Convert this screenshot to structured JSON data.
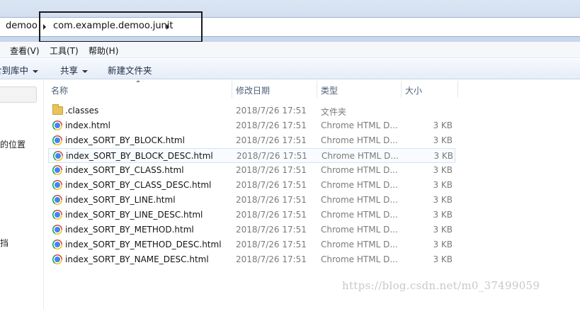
{
  "address_bar": {
    "crumbs": [
      "demoo",
      "com.example.demoo.junit"
    ]
  },
  "menu": {
    "items": [
      "查看(V)",
      "工具(T)",
      "帮助(H)"
    ]
  },
  "toolbar": {
    "include_library": "含到库中",
    "share": "共享",
    "new_folder": "新建文件夹"
  },
  "nav": {
    "item_recent_places": "的位置",
    "item_docs": "挡"
  },
  "columns": {
    "name": "名称",
    "date": "修改日期",
    "type": "类型",
    "size": "大小"
  },
  "files": [
    {
      "name": ".classes",
      "date": "2018/7/26 17:51",
      "type": "文件夹",
      "size": "",
      "icon": "folder-icon"
    },
    {
      "name": "index.html",
      "date": "2018/7/26 17:51",
      "type": "Chrome HTML D...",
      "size": "3 KB",
      "icon": "chrome-icon"
    },
    {
      "name": "index_SORT_BY_BLOCK.html",
      "date": "2018/7/26 17:51",
      "type": "Chrome HTML D...",
      "size": "3 KB",
      "icon": "chrome-icon"
    },
    {
      "name": "index_SORT_BY_BLOCK_DESC.html",
      "date": "2018/7/26 17:51",
      "type": "Chrome HTML D...",
      "size": "3 KB",
      "icon": "chrome-icon",
      "selected": true
    },
    {
      "name": "index_SORT_BY_CLASS.html",
      "date": "2018/7/26 17:51",
      "type": "Chrome HTML D...",
      "size": "3 KB",
      "icon": "chrome-icon"
    },
    {
      "name": "index_SORT_BY_CLASS_DESC.html",
      "date": "2018/7/26 17:51",
      "type": "Chrome HTML D...",
      "size": "3 KB",
      "icon": "chrome-icon"
    },
    {
      "name": "index_SORT_BY_LINE.html",
      "date": "2018/7/26 17:51",
      "type": "Chrome HTML D...",
      "size": "3 KB",
      "icon": "chrome-icon"
    },
    {
      "name": "index_SORT_BY_LINE_DESC.html",
      "date": "2018/7/26 17:51",
      "type": "Chrome HTML D...",
      "size": "3 KB",
      "icon": "chrome-icon"
    },
    {
      "name": "index_SORT_BY_METHOD.html",
      "date": "2018/7/26 17:51",
      "type": "Chrome HTML D...",
      "size": "3 KB",
      "icon": "chrome-icon"
    },
    {
      "name": "index_SORT_BY_METHOD_DESC.html",
      "date": "2018/7/26 17:51",
      "type": "Chrome HTML D...",
      "size": "3 KB",
      "icon": "chrome-icon"
    },
    {
      "name": "index_SORT_BY_NAME_DESC.html",
      "date": "2018/7/26 17:51",
      "type": "Chrome HTML D...",
      "size": "3 KB",
      "icon": "chrome-icon"
    }
  ],
  "watermark": "https://blog.csdn.net/m0_37499059"
}
